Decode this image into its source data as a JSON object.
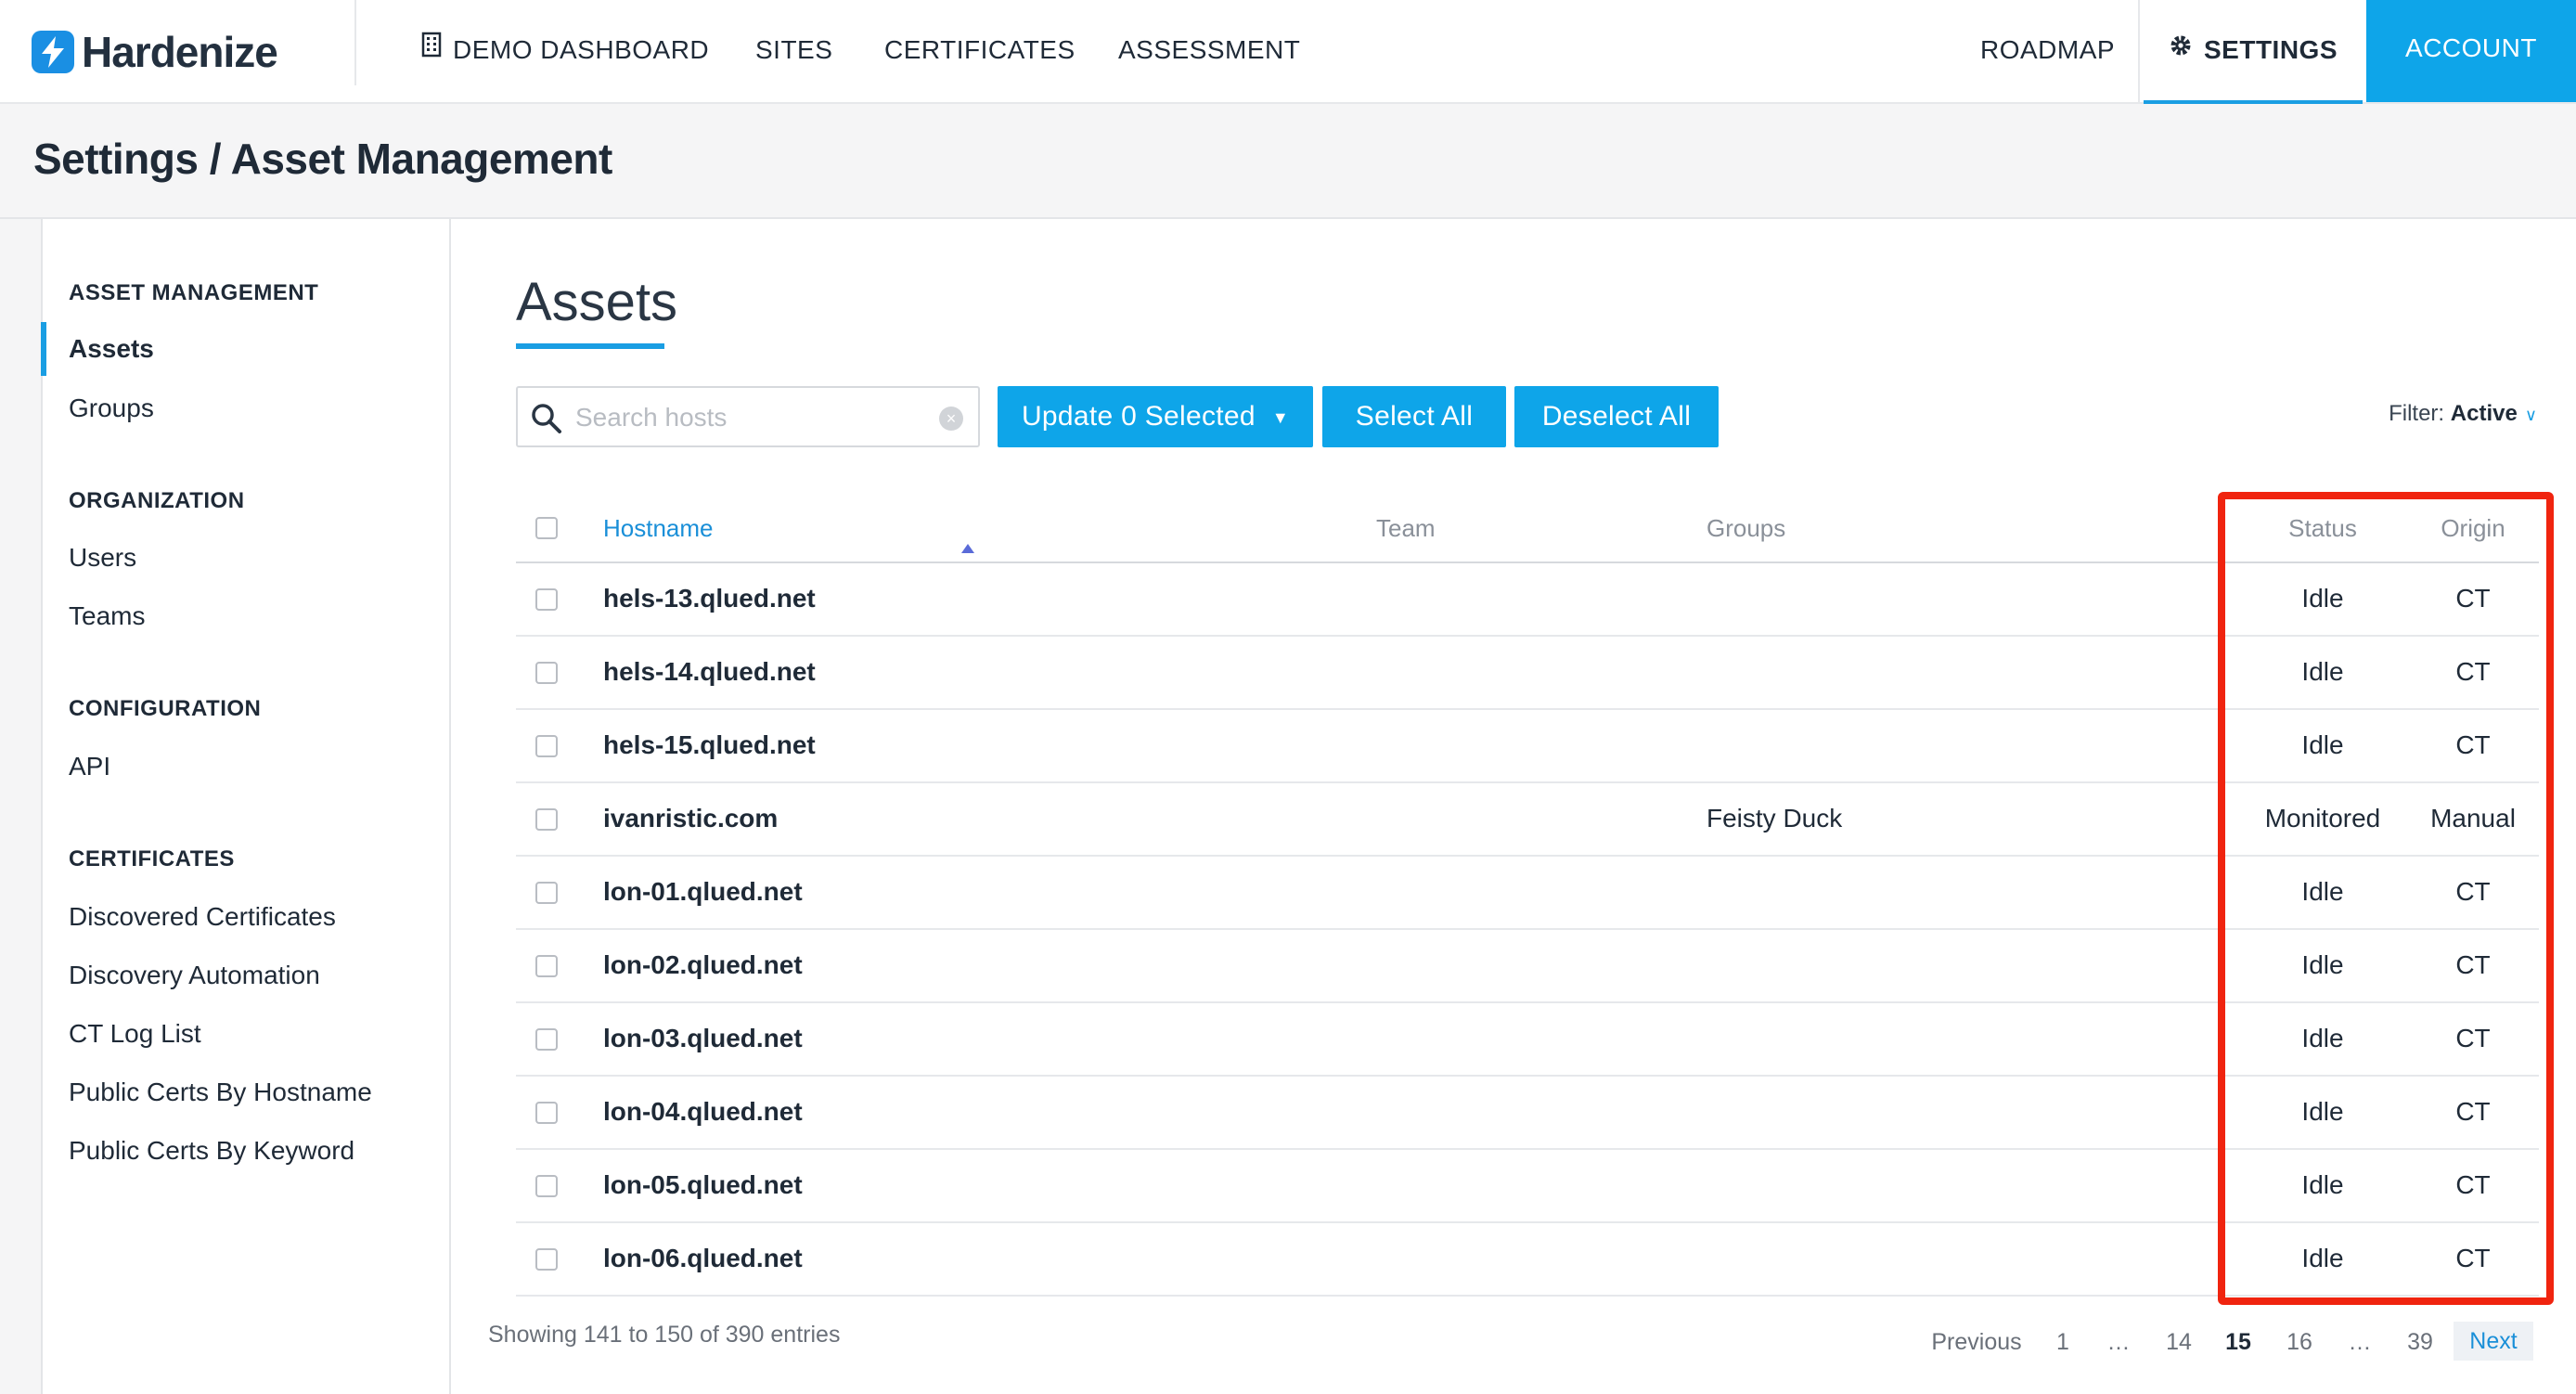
{
  "app": {
    "brand": "Hardenize"
  },
  "topnav": {
    "items": [
      {
        "label": "DEMO DASHBOARD",
        "icon": "building-icon"
      },
      {
        "label": "SITES"
      },
      {
        "label": "CERTIFICATES"
      },
      {
        "label": "ASSESSMENT"
      }
    ],
    "roadmap": "ROADMAP",
    "settings": "SETTINGS",
    "settings_icon": "gear-icon",
    "account": "ACCOUNT"
  },
  "breadcrumb": "Settings / Asset Management",
  "sidebar": {
    "sections": [
      {
        "heading": "ASSET MANAGEMENT",
        "items": [
          "Assets",
          "Groups"
        ]
      },
      {
        "heading": "ORGANIZATION",
        "items": [
          "Users",
          "Teams"
        ]
      },
      {
        "heading": "CONFIGURATION",
        "items": [
          "API"
        ]
      },
      {
        "heading": "CERTIFICATES",
        "items": [
          "Discovered Certificates",
          "Discovery Automation",
          "CT Log List",
          "Public Certs By Hostname",
          "Public Certs By Keyword"
        ]
      }
    ],
    "active_item": "Assets"
  },
  "main": {
    "title": "Assets",
    "search_placeholder": "Search hosts",
    "search_value": "",
    "update_button": "Update 0 Selected",
    "select_all": "Select All",
    "deselect_all": "Deselect All",
    "filter_label": "Filter:",
    "filter_value": "Active"
  },
  "table": {
    "columns": [
      "Hostname",
      "Team",
      "Groups",
      "Status",
      "Origin"
    ],
    "sort_column": "Hostname",
    "rows": [
      {
        "hostname": "hels-13.qlued.net",
        "team": "",
        "groups": "",
        "status": "Idle",
        "origin": "CT"
      },
      {
        "hostname": "hels-14.qlued.net",
        "team": "",
        "groups": "",
        "status": "Idle",
        "origin": "CT"
      },
      {
        "hostname": "hels-15.qlued.net",
        "team": "",
        "groups": "",
        "status": "Idle",
        "origin": "CT"
      },
      {
        "hostname": "ivanristic.com",
        "team": "",
        "groups": "Feisty Duck",
        "status": "Monitored",
        "origin": "Manual"
      },
      {
        "hostname": "lon-01.qlued.net",
        "team": "",
        "groups": "",
        "status": "Idle",
        "origin": "CT"
      },
      {
        "hostname": "lon-02.qlued.net",
        "team": "",
        "groups": "",
        "status": "Idle",
        "origin": "CT"
      },
      {
        "hostname": "lon-03.qlued.net",
        "team": "",
        "groups": "",
        "status": "Idle",
        "origin": "CT"
      },
      {
        "hostname": "lon-04.qlued.net",
        "team": "",
        "groups": "",
        "status": "Idle",
        "origin": "CT"
      },
      {
        "hostname": "lon-05.qlued.net",
        "team": "",
        "groups": "",
        "status": "Idle",
        "origin": "CT"
      },
      {
        "hostname": "lon-06.qlued.net",
        "team": "",
        "groups": "",
        "status": "Idle",
        "origin": "CT"
      }
    ]
  },
  "pagination": {
    "showing": "Showing 141 to 150 of 390 entries",
    "previous": "Previous",
    "pages": [
      "1",
      "…",
      "14",
      "15",
      "16",
      "…",
      "39"
    ],
    "current": "15",
    "next": "Next"
  },
  "colors": {
    "accent": "#0ea5e9",
    "highlight_box": "#f0240f"
  }
}
